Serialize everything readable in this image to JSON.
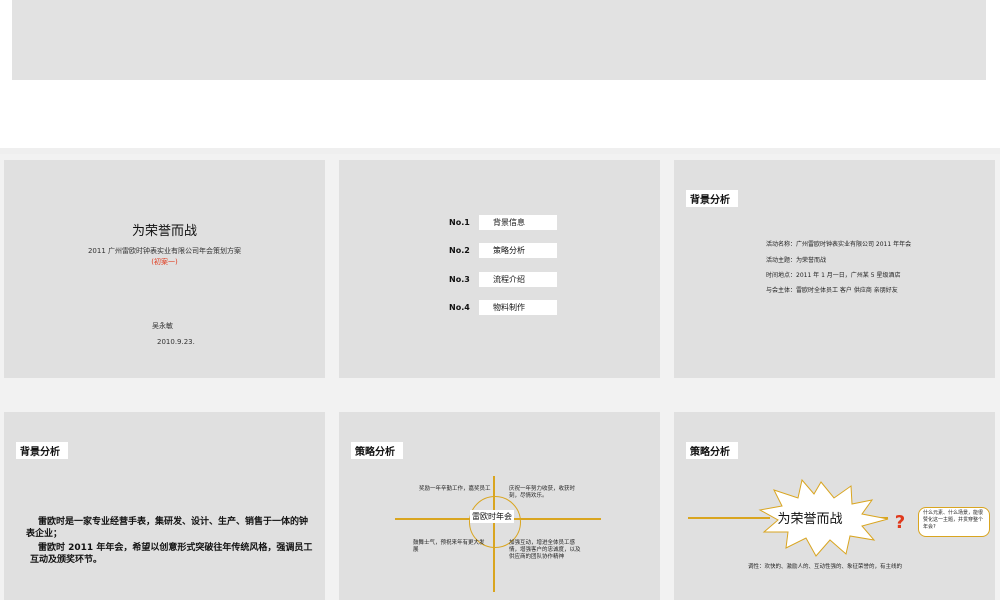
{
  "slide1": {
    "title": "为荣誉而战",
    "subtitle": "2011 广州雷欧时钟表实业有限公司年会策划方案",
    "draft": "(初案一)",
    "author": "吴永敏",
    "date": "2010.9.23."
  },
  "slide2": {
    "items": [
      {
        "num": "No.1",
        "label": "背景信息"
      },
      {
        "num": "No.2",
        "label": "策略分析"
      },
      {
        "num": "No.3",
        "label": "流程介绍"
      },
      {
        "num": "No.4",
        "label": "物料制作"
      }
    ]
  },
  "slide3": {
    "header": "背景分析",
    "lines": [
      "活动名称：广州雷欧时钟表实业有限公司 2011 年年会",
      "活动主题：为荣誉而战",
      "时间地点：2011 年 1 月一日，广州某 5 星级酒店",
      "与会主体：雷欧时全体员工 客户 供应商 亲朋好友"
    ]
  },
  "slide4": {
    "header": "背景分析",
    "para1": "雷欧时是一家专业经营手表，集研发、设计、生产、销售于一体的钟表企业；",
    "para2": "雷欧时 2011 年年会，希望以创意形式突破往年传统风格，强调员工互动及颁奖环节。"
  },
  "slide5": {
    "header": "策略分析",
    "center": "雷欧时年会",
    "q1": "奖励一年辛勤工作，嘉奖员工",
    "q2": "庆祝一年努力收获，收获时刻，尽情欢乐。",
    "q3": "鼓舞士气，预祝来年有更大发展",
    "q4": "加强互动，增进全体员工感情，增强客户的忠诚度，以及供应商的团队协作精神"
  },
  "slide6": {
    "header": "策略分析",
    "burst_text": "为荣誉而战",
    "question_mark": "?",
    "callout": "什么元素、什么场景，能很赞化这一主题，并贯穿整个年会?",
    "tone": "调性：欢快的、激励人的、互动性强的、象征荣誉的，有主线的"
  },
  "colors": {
    "accent": "#d9a520",
    "red": "#e0391c",
    "slide_bg": "#e0e0e0"
  }
}
